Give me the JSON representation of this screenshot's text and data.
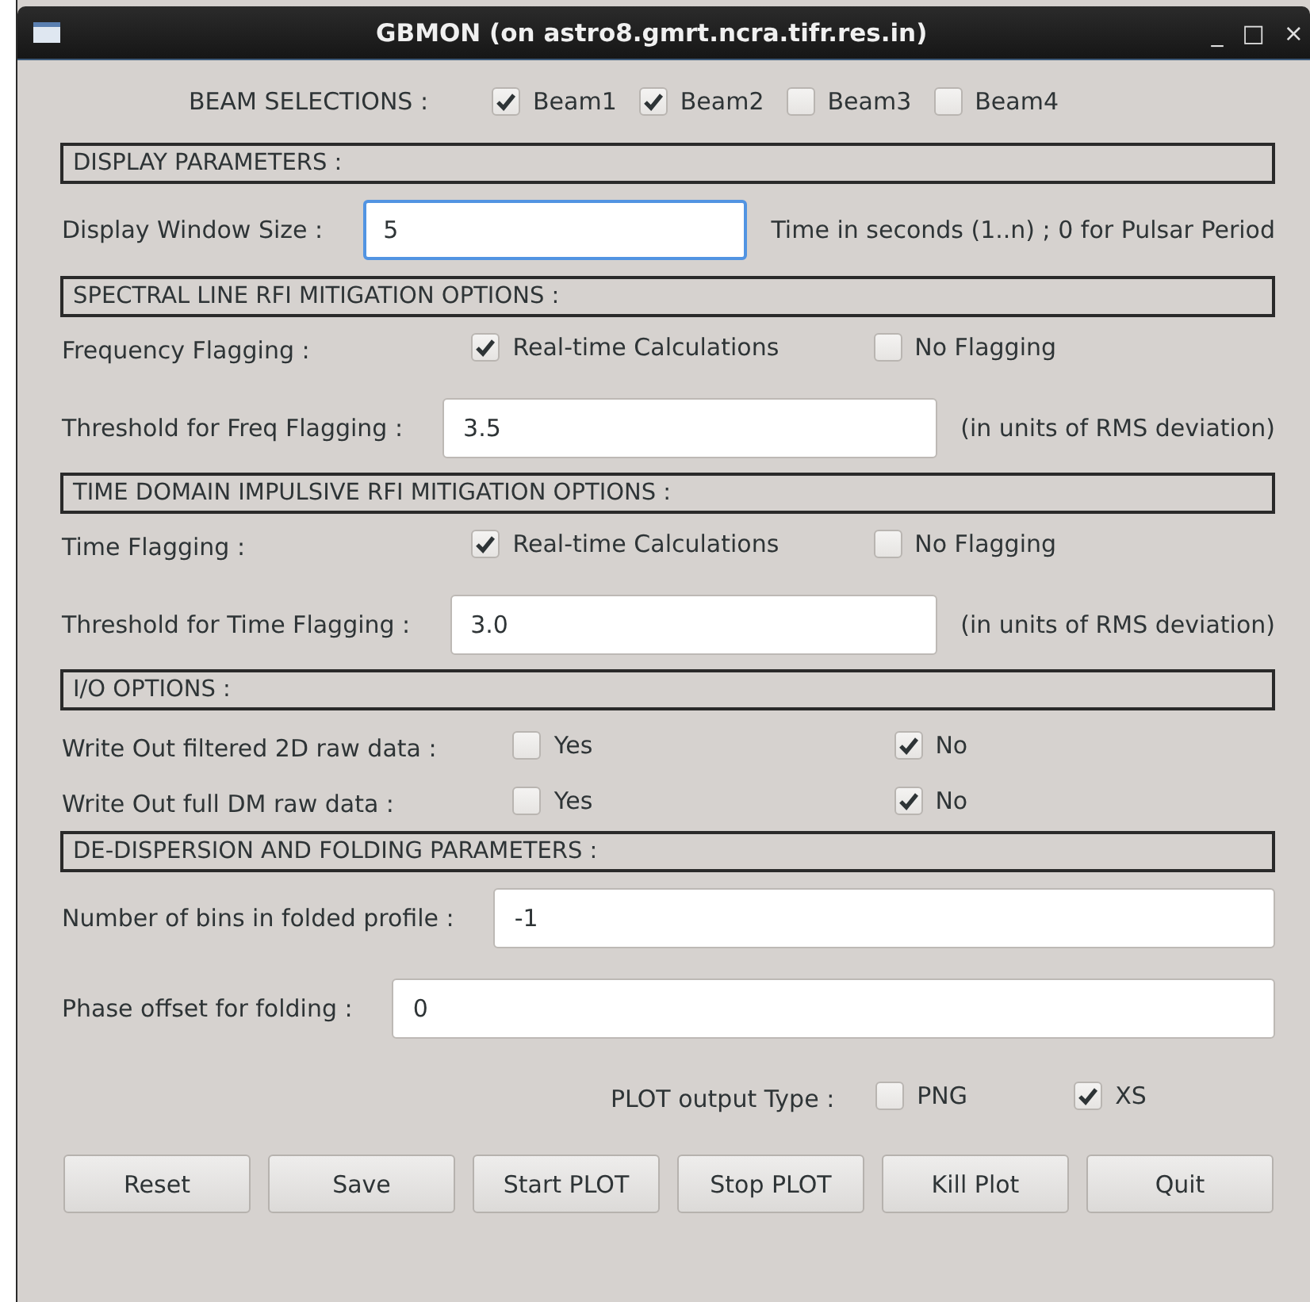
{
  "window": {
    "title": "GBMON (on astro8.gmrt.ncra.tifr.res.in)",
    "controls": [
      "_",
      "□",
      "×"
    ]
  },
  "beam_selections": {
    "label": "BEAM SELECTIONS :",
    "beams": [
      {
        "label": "Beam1",
        "checked": true
      },
      {
        "label": "Beam2",
        "checked": true
      },
      {
        "label": "Beam3",
        "checked": false
      },
      {
        "label": "Beam4",
        "checked": false
      }
    ]
  },
  "sections": [
    {
      "title": "DISPLAY PARAMETERS :",
      "rows": [
        {
          "kind": "field",
          "label": "Display Window Size :",
          "value": "5",
          "focused": true,
          "hint": "Time in seconds (1..n) ; 0 for Pulsar Period"
        }
      ]
    },
    {
      "title": "SPECTRAL LINE RFI MITIGATION OPTIONS :",
      "rows": [
        {
          "kind": "flag",
          "label": "Frequency Flagging :",
          "options": [
            {
              "label": "Real-time Calculations",
              "checked": true
            },
            {
              "label": "No Flagging",
              "checked": false
            }
          ]
        },
        {
          "kind": "field",
          "label": "Threshold for Freq Flagging :",
          "value": "3.5",
          "focused": false,
          "hint": "(in units of RMS deviation)"
        }
      ]
    },
    {
      "title": "TIME DOMAIN IMPULSIVE RFI MITIGATION OPTIONS :",
      "rows": [
        {
          "kind": "flag",
          "label": "Time Flagging :",
          "options": [
            {
              "label": "Real-time Calculations",
              "checked": true
            },
            {
              "label": "No Flagging",
              "checked": false
            }
          ]
        },
        {
          "kind": "field",
          "label": "Threshold for Time Flagging :",
          "value": "3.0",
          "focused": false,
          "hint": "(in units of RMS deviation)"
        }
      ]
    },
    {
      "title": "I/O OPTIONS :",
      "rows": [
        {
          "kind": "yesno",
          "label": "Write Out filtered 2D raw data :",
          "options": [
            {
              "label": "Yes",
              "checked": false
            },
            {
              "label": "No",
              "checked": true
            }
          ]
        },
        {
          "kind": "yesno",
          "label": "Write Out full DM raw data :",
          "options": [
            {
              "label": "Yes",
              "checked": false
            },
            {
              "label": "No",
              "checked": true
            }
          ]
        }
      ]
    },
    {
      "title": "DE-DISPERSION AND FOLDING PARAMETERS :",
      "rows": [
        {
          "kind": "field",
          "label": "Number of bins in folded profile :",
          "value": "-1",
          "focused": false
        },
        {
          "kind": "field",
          "label": "Phase offset for folding :",
          "value": "0",
          "focused": false
        }
      ]
    }
  ],
  "plot_output": {
    "label": "PLOT output Type :",
    "options": [
      {
        "label": "PNG",
        "checked": false
      },
      {
        "label": "XS",
        "checked": true
      }
    ]
  },
  "buttons": [
    "Reset",
    "Save",
    "Start PLOT",
    "Stop PLOT",
    "Kill Plot",
    "Quit"
  ]
}
